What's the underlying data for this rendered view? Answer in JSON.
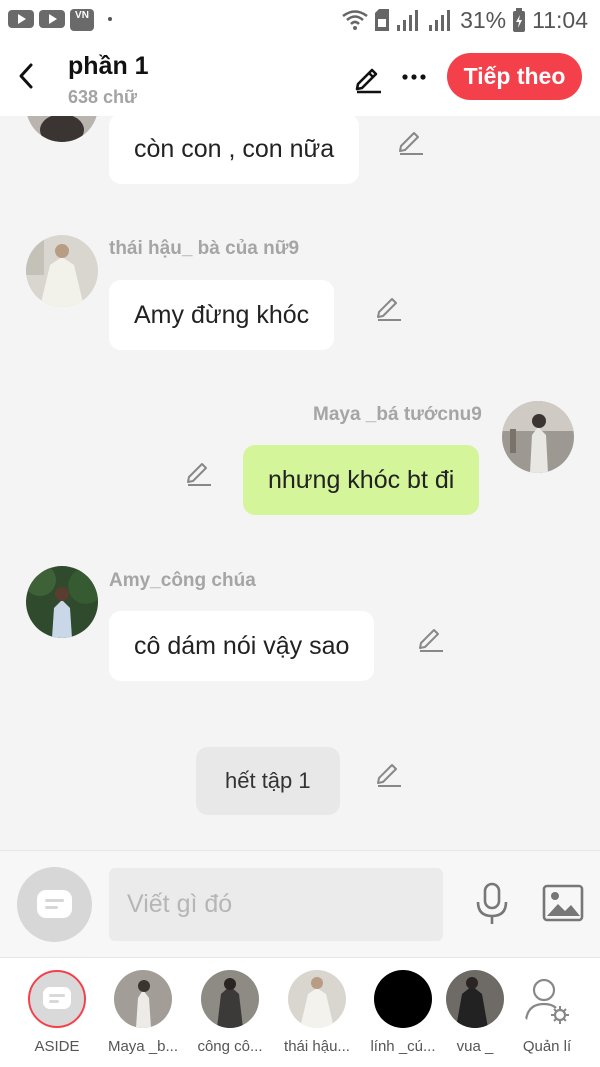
{
  "status_bar": {
    "battery": "31%",
    "time": "11:04",
    "app_icons": [
      "youtube-icon",
      "youtube-icon",
      "vn-news-icon"
    ]
  },
  "header": {
    "title": "phần 1",
    "word_count": "638 chữ",
    "next_label": "Tiếp theo"
  },
  "messages": [
    {
      "sender": "",
      "text": "còn con , con nữa",
      "side": "left"
    },
    {
      "sender": "thái hậu_ bà của nữ9",
      "text": "Amy đừng khóc",
      "side": "left"
    },
    {
      "sender": "Maya _bá tướcnu9",
      "text": "nhưng khóc bt đi",
      "side": "right"
    },
    {
      "sender": "Amy_công chúa",
      "text": "cô dám nói vậy sao",
      "side": "left"
    },
    {
      "sender": "",
      "text": "hết tập 1",
      "side": "narration"
    }
  ],
  "composer": {
    "placeholder": "Viết gì đó"
  },
  "characters": [
    {
      "label": "ASIDE"
    },
    {
      "label": "Maya _b..."
    },
    {
      "label": "công cô..."
    },
    {
      "label": "thái hậu..."
    },
    {
      "label": "lính _cú..."
    },
    {
      "label": "vua _"
    },
    {
      "label": "Quản lí"
    }
  ],
  "colors": {
    "accent": "#f4404b",
    "my_bubble": "#d4f59a",
    "other_bubble": "#ffffff",
    "background": "#f4f4f4"
  }
}
